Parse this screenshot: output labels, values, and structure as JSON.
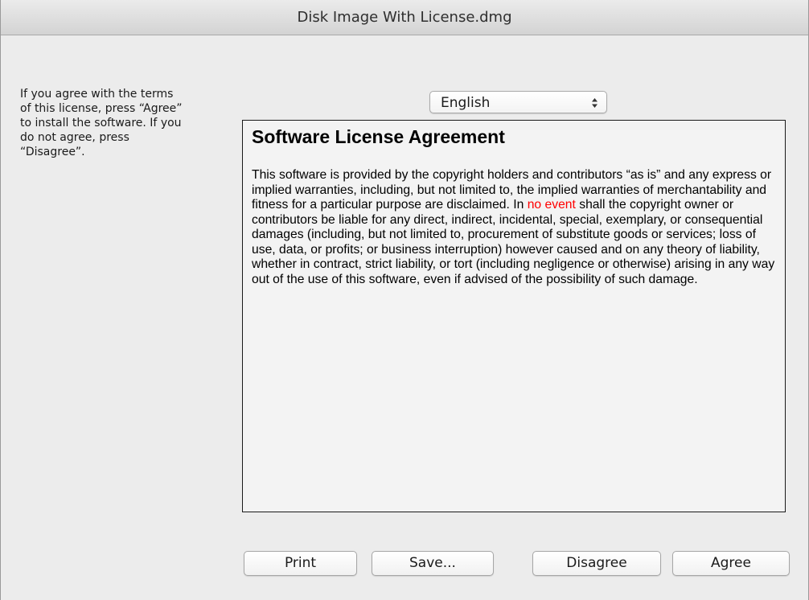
{
  "window": {
    "title": "Disk Image With License.dmg"
  },
  "instructions": "If you agree with the terms\nof this license, press “Agree”\nto install the software. If you\ndo not agree, press\n“Disagree”.",
  "language_select": {
    "selected": "English"
  },
  "license": {
    "title": "Software License Agreement",
    "body_before": "This software is provided by the copyright holders and contributors “as is” and any express or implied warranties, including, but not limited to, the implied warranties of merchantability and fitness for a particular purpose are disclaimed. In ",
    "highlight": "no event",
    "highlight_color": "#ff0000",
    "body_after": " shall the copyright owner or contributors be liable for any direct, indirect, incidental, special, exemplary, or consequential damages (including, but not limited to, procurement of substitute goods or services; loss of use, data, or profits; or business interruption) however caused and on any theory of liability, whether in contract, strict liability, or tort (including negligence or otherwise) arising in any way out of the use of this software, even if advised of the possibility of such damage."
  },
  "buttons": {
    "print": "Print",
    "save": "Save...",
    "disagree": "Disagree",
    "agree": "Agree"
  },
  "icons": {
    "select_arrows": "up-down-arrows-icon"
  }
}
